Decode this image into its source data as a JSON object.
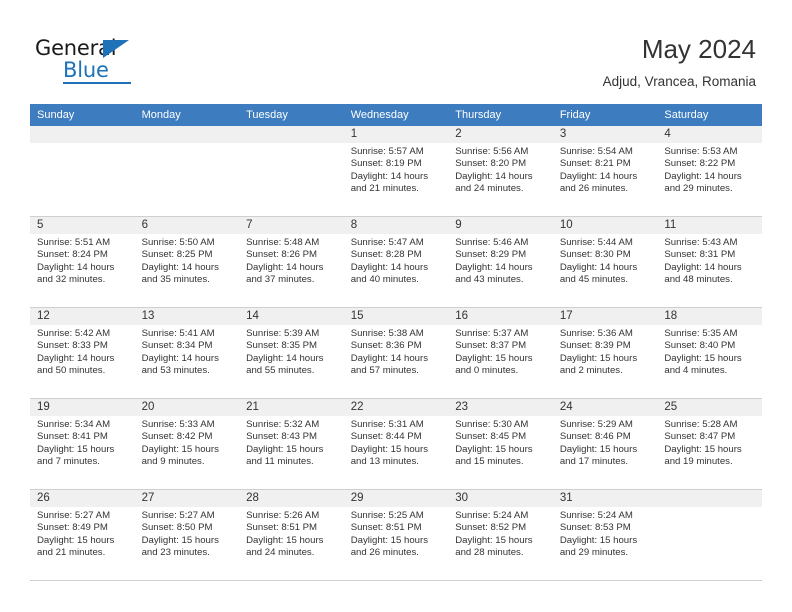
{
  "brand": {
    "name_top": "General",
    "name_bottom": "Blue",
    "accent_color": "#1f72b8"
  },
  "header": {
    "title": "May 2024",
    "subtitle": "Adjud, Vrancea, Romania"
  },
  "calendar": {
    "header_background": "#3c7cbf",
    "daynum_background": "#f0f0f0",
    "weekday_headers": [
      "Sunday",
      "Monday",
      "Tuesday",
      "Wednesday",
      "Thursday",
      "Friday",
      "Saturday"
    ],
    "weeks": [
      [
        {
          "day": "",
          "sunrise": "",
          "sunset": "",
          "daylight_line1": "",
          "daylight_line2": ""
        },
        {
          "day": "",
          "sunrise": "",
          "sunset": "",
          "daylight_line1": "",
          "daylight_line2": ""
        },
        {
          "day": "",
          "sunrise": "",
          "sunset": "",
          "daylight_line1": "",
          "daylight_line2": ""
        },
        {
          "day": "1",
          "sunrise": "Sunrise: 5:57 AM",
          "sunset": "Sunset: 8:19 PM",
          "daylight_line1": "Daylight: 14 hours",
          "daylight_line2": "and 21 minutes."
        },
        {
          "day": "2",
          "sunrise": "Sunrise: 5:56 AM",
          "sunset": "Sunset: 8:20 PM",
          "daylight_line1": "Daylight: 14 hours",
          "daylight_line2": "and 24 minutes."
        },
        {
          "day": "3",
          "sunrise": "Sunrise: 5:54 AM",
          "sunset": "Sunset: 8:21 PM",
          "daylight_line1": "Daylight: 14 hours",
          "daylight_line2": "and 26 minutes."
        },
        {
          "day": "4",
          "sunrise": "Sunrise: 5:53 AM",
          "sunset": "Sunset: 8:22 PM",
          "daylight_line1": "Daylight: 14 hours",
          "daylight_line2": "and 29 minutes."
        }
      ],
      [
        {
          "day": "5",
          "sunrise": "Sunrise: 5:51 AM",
          "sunset": "Sunset: 8:24 PM",
          "daylight_line1": "Daylight: 14 hours",
          "daylight_line2": "and 32 minutes."
        },
        {
          "day": "6",
          "sunrise": "Sunrise: 5:50 AM",
          "sunset": "Sunset: 8:25 PM",
          "daylight_line1": "Daylight: 14 hours",
          "daylight_line2": "and 35 minutes."
        },
        {
          "day": "7",
          "sunrise": "Sunrise: 5:48 AM",
          "sunset": "Sunset: 8:26 PM",
          "daylight_line1": "Daylight: 14 hours",
          "daylight_line2": "and 37 minutes."
        },
        {
          "day": "8",
          "sunrise": "Sunrise: 5:47 AM",
          "sunset": "Sunset: 8:28 PM",
          "daylight_line1": "Daylight: 14 hours",
          "daylight_line2": "and 40 minutes."
        },
        {
          "day": "9",
          "sunrise": "Sunrise: 5:46 AM",
          "sunset": "Sunset: 8:29 PM",
          "daylight_line1": "Daylight: 14 hours",
          "daylight_line2": "and 43 minutes."
        },
        {
          "day": "10",
          "sunrise": "Sunrise: 5:44 AM",
          "sunset": "Sunset: 8:30 PM",
          "daylight_line1": "Daylight: 14 hours",
          "daylight_line2": "and 45 minutes."
        },
        {
          "day": "11",
          "sunrise": "Sunrise: 5:43 AM",
          "sunset": "Sunset: 8:31 PM",
          "daylight_line1": "Daylight: 14 hours",
          "daylight_line2": "and 48 minutes."
        }
      ],
      [
        {
          "day": "12",
          "sunrise": "Sunrise: 5:42 AM",
          "sunset": "Sunset: 8:33 PM",
          "daylight_line1": "Daylight: 14 hours",
          "daylight_line2": "and 50 minutes."
        },
        {
          "day": "13",
          "sunrise": "Sunrise: 5:41 AM",
          "sunset": "Sunset: 8:34 PM",
          "daylight_line1": "Daylight: 14 hours",
          "daylight_line2": "and 53 minutes."
        },
        {
          "day": "14",
          "sunrise": "Sunrise: 5:39 AM",
          "sunset": "Sunset: 8:35 PM",
          "daylight_line1": "Daylight: 14 hours",
          "daylight_line2": "and 55 minutes."
        },
        {
          "day": "15",
          "sunrise": "Sunrise: 5:38 AM",
          "sunset": "Sunset: 8:36 PM",
          "daylight_line1": "Daylight: 14 hours",
          "daylight_line2": "and 57 minutes."
        },
        {
          "day": "16",
          "sunrise": "Sunrise: 5:37 AM",
          "sunset": "Sunset: 8:37 PM",
          "daylight_line1": "Daylight: 15 hours",
          "daylight_line2": "and 0 minutes."
        },
        {
          "day": "17",
          "sunrise": "Sunrise: 5:36 AM",
          "sunset": "Sunset: 8:39 PM",
          "daylight_line1": "Daylight: 15 hours",
          "daylight_line2": "and 2 minutes."
        },
        {
          "day": "18",
          "sunrise": "Sunrise: 5:35 AM",
          "sunset": "Sunset: 8:40 PM",
          "daylight_line1": "Daylight: 15 hours",
          "daylight_line2": "and 4 minutes."
        }
      ],
      [
        {
          "day": "19",
          "sunrise": "Sunrise: 5:34 AM",
          "sunset": "Sunset: 8:41 PM",
          "daylight_line1": "Daylight: 15 hours",
          "daylight_line2": "and 7 minutes."
        },
        {
          "day": "20",
          "sunrise": "Sunrise: 5:33 AM",
          "sunset": "Sunset: 8:42 PM",
          "daylight_line1": "Daylight: 15 hours",
          "daylight_line2": "and 9 minutes."
        },
        {
          "day": "21",
          "sunrise": "Sunrise: 5:32 AM",
          "sunset": "Sunset: 8:43 PM",
          "daylight_line1": "Daylight: 15 hours",
          "daylight_line2": "and 11 minutes."
        },
        {
          "day": "22",
          "sunrise": "Sunrise: 5:31 AM",
          "sunset": "Sunset: 8:44 PM",
          "daylight_line1": "Daylight: 15 hours",
          "daylight_line2": "and 13 minutes."
        },
        {
          "day": "23",
          "sunrise": "Sunrise: 5:30 AM",
          "sunset": "Sunset: 8:45 PM",
          "daylight_line1": "Daylight: 15 hours",
          "daylight_line2": "and 15 minutes."
        },
        {
          "day": "24",
          "sunrise": "Sunrise: 5:29 AM",
          "sunset": "Sunset: 8:46 PM",
          "daylight_line1": "Daylight: 15 hours",
          "daylight_line2": "and 17 minutes."
        },
        {
          "day": "25",
          "sunrise": "Sunrise: 5:28 AM",
          "sunset": "Sunset: 8:47 PM",
          "daylight_line1": "Daylight: 15 hours",
          "daylight_line2": "and 19 minutes."
        }
      ],
      [
        {
          "day": "26",
          "sunrise": "Sunrise: 5:27 AM",
          "sunset": "Sunset: 8:49 PM",
          "daylight_line1": "Daylight: 15 hours",
          "daylight_line2": "and 21 minutes."
        },
        {
          "day": "27",
          "sunrise": "Sunrise: 5:27 AM",
          "sunset": "Sunset: 8:50 PM",
          "daylight_line1": "Daylight: 15 hours",
          "daylight_line2": "and 23 minutes."
        },
        {
          "day": "28",
          "sunrise": "Sunrise: 5:26 AM",
          "sunset": "Sunset: 8:51 PM",
          "daylight_line1": "Daylight: 15 hours",
          "daylight_line2": "and 24 minutes."
        },
        {
          "day": "29",
          "sunrise": "Sunrise: 5:25 AM",
          "sunset": "Sunset: 8:51 PM",
          "daylight_line1": "Daylight: 15 hours",
          "daylight_line2": "and 26 minutes."
        },
        {
          "day": "30",
          "sunrise": "Sunrise: 5:24 AM",
          "sunset": "Sunset: 8:52 PM",
          "daylight_line1": "Daylight: 15 hours",
          "daylight_line2": "and 28 minutes."
        },
        {
          "day": "31",
          "sunrise": "Sunrise: 5:24 AM",
          "sunset": "Sunset: 8:53 PM",
          "daylight_line1": "Daylight: 15 hours",
          "daylight_line2": "and 29 minutes."
        },
        {
          "day": "",
          "sunrise": "",
          "sunset": "",
          "daylight_line1": "",
          "daylight_line2": ""
        }
      ]
    ]
  }
}
